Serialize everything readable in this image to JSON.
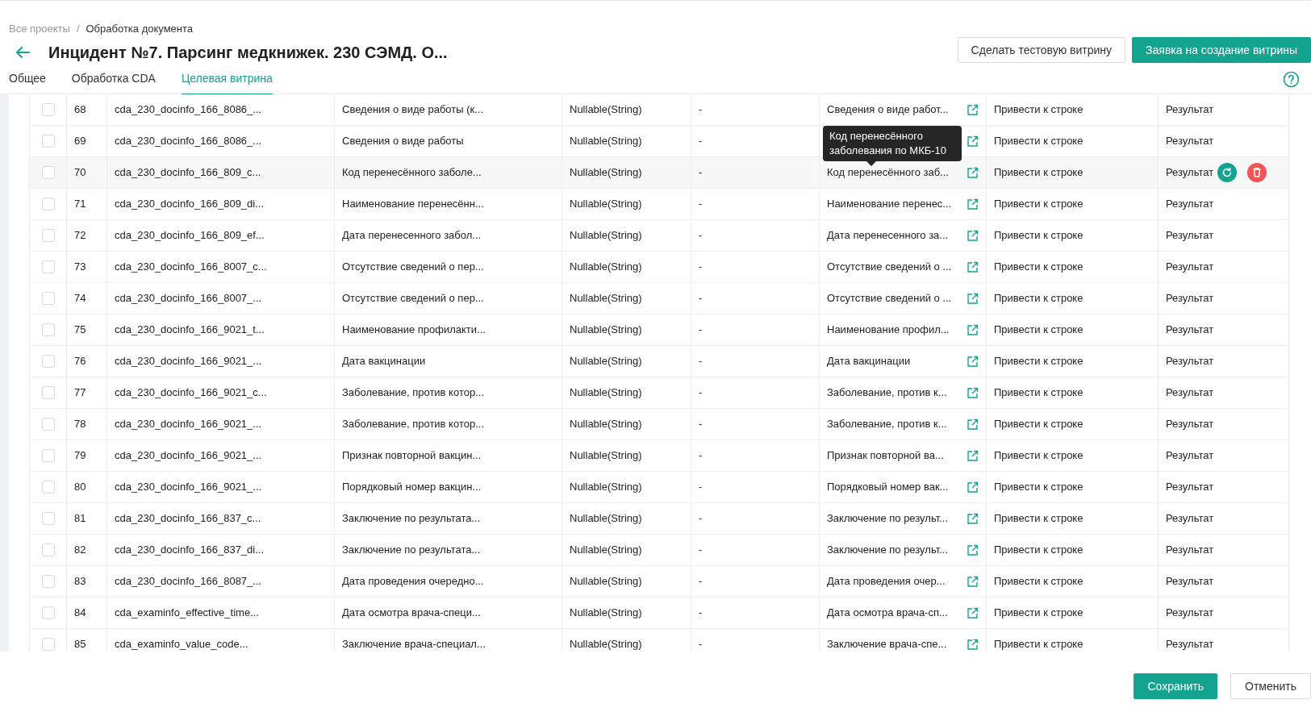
{
  "breadcrumb": {
    "separator": "/",
    "items": [
      {
        "label": "Все проекты",
        "current": false
      },
      {
        "label": "Обработка документа",
        "current": true
      }
    ]
  },
  "title": "Инцидент №7. Парсинг медкнижек. 230 СЭМД. О...",
  "header_buttons": [
    {
      "label": "Сделать тестовую витрину",
      "kind": "secondary"
    },
    {
      "label": "Заявка на создание витрины",
      "kind": "primary"
    }
  ],
  "tabs": [
    {
      "label": "Общее",
      "selected": false
    },
    {
      "label": "Обработка CDA",
      "selected": false
    },
    {
      "label": "Целевая витрина",
      "selected": true
    }
  ],
  "table": {
    "rows": [
      {
        "checked": false,
        "number": "68",
        "column_name": "cda_230_docinfo_166_8086_...",
        "description": "Сведения о виде работы (к...",
        "type": "Nullable(String)",
        "column_5": "-",
        "target": "Сведения о виде работ...",
        "transform": "Привести к строке",
        "column_8": "Результат",
        "hovered": false
      },
      {
        "checked": false,
        "number": "69",
        "column_name": "cda_230_docinfo_166_8086_...",
        "description": "Сведения о виде работы",
        "type": "Nullable(String)",
        "column_5": "-",
        "transform": "Привести к строке",
        "column_8": "Результат",
        "hovered": false
      },
      {
        "checked": false,
        "number": "70",
        "column_name": "cda_230_docinfo_166_809_c...",
        "description": "Код перенесённого заболе...",
        "type": "Nullable(String)",
        "column_5": "-",
        "target": "Код перенесённого заб...",
        "transform": "Привести к строке",
        "column_8": "Результат",
        "hovered": true
      },
      {
        "checked": false,
        "number": "71",
        "column_name": "cda_230_docinfo_166_809_di...",
        "description": "Наименование перенесённ...",
        "type": "Nullable(String)",
        "column_5": "-",
        "target": "Наименование перенес...",
        "transform": "Привести к строке",
        "column_8": "Результат",
        "hovered": false
      },
      {
        "checked": false,
        "number": "72",
        "column_name": "cda_230_docinfo_166_809_ef...",
        "description": "Дата перенесенного забол...",
        "type": "Nullable(String)",
        "column_5": "-",
        "target": "Дата перенесенного за...",
        "transform": "Привести к строке",
        "column_8": "Результат",
        "hovered": false
      },
      {
        "checked": false,
        "number": "73",
        "column_name": "cda_230_docinfo_166_8007_c...",
        "description": "Отсутствие сведений о пер...",
        "type": "Nullable(String)",
        "column_5": "-",
        "target": "Отсутствие сведений о ...",
        "transform": "Привести к строке",
        "column_8": "Результат",
        "hovered": false
      },
      {
        "checked": false,
        "number": "74",
        "column_name": "cda_230_docinfo_166_8007_...",
        "description": "Отсутствие сведений о пер...",
        "type": "Nullable(String)",
        "column_5": "-",
        "target": "Отсутствие сведений о ...",
        "transform": "Привести к строке",
        "column_8": "Результат",
        "hovered": false
      },
      {
        "checked": false,
        "number": "75",
        "column_name": "cda_230_docinfo_166_9021_t...",
        "description": "Наименование профилакти...",
        "type": "Nullable(String)",
        "column_5": "-",
        "target": "Наименование профил...",
        "transform": "Привести к строке",
        "column_8": "Результат",
        "hovered": false
      },
      {
        "checked": false,
        "number": "76",
        "column_name": "cda_230_docinfo_166_9021_...",
        "description": "Дата вакцинации",
        "type": "Nullable(String)",
        "column_5": "-",
        "target": "Дата вакцинации",
        "transform": "Привести к строке",
        "column_8": "Результат",
        "hovered": false
      },
      {
        "checked": false,
        "number": "77",
        "column_name": "cda_230_docinfo_166_9021_c...",
        "description": "Заболевание, против котор...",
        "type": "Nullable(String)",
        "column_5": "-",
        "target": "Заболевание, против к...",
        "transform": "Привести к строке",
        "column_8": "Результат",
        "hovered": false
      },
      {
        "checked": false,
        "number": "78",
        "column_name": "cda_230_docinfo_166_9021_...",
        "description": "Заболевание, против котор...",
        "type": "Nullable(String)",
        "column_5": "-",
        "target": "Заболевание, против к...",
        "transform": "Привести к строке",
        "column_8": "Результат",
        "hovered": false
      },
      {
        "checked": false,
        "number": "79",
        "column_name": "cda_230_docinfo_166_9021_...",
        "description": "Признак повторной вакцин...",
        "type": "Nullable(String)",
        "column_5": "-",
        "target": "Признак повторной ва...",
        "transform": "Привести к строке",
        "column_8": "Результат",
        "hovered": false
      },
      {
        "checked": false,
        "number": "80",
        "column_name": "cda_230_docinfo_166_9021_...",
        "description": "Порядковый номер вакцин...",
        "type": "Nullable(String)",
        "column_5": "-",
        "target": "Порядковый номер вак...",
        "transform": "Привести к строке",
        "column_8": "Результат",
        "hovered": false
      },
      {
        "checked": false,
        "number": "81",
        "column_name": "cda_230_docinfo_166_837_c...",
        "description": "Заключение по результата...",
        "type": "Nullable(String)",
        "column_5": "-",
        "target": "Заключение по результ...",
        "transform": "Привести к строке",
        "column_8": "Результат",
        "hovered": false
      },
      {
        "checked": false,
        "number": "82",
        "column_name": "cda_230_docinfo_166_837_di...",
        "description": "Заключение по результата...",
        "type": "Nullable(String)",
        "column_5": "-",
        "target": "Заключение по результ...",
        "transform": "Привести к строке",
        "column_8": "Результат",
        "hovered": false
      },
      {
        "checked": false,
        "number": "83",
        "column_name": "cda_230_docinfo_166_8087_...",
        "description": "Дата проведения очередно...",
        "type": "Nullable(String)",
        "column_5": "-",
        "target": "Дата проведения очер...",
        "transform": "Привести к строке",
        "column_8": "Результат",
        "hovered": false
      },
      {
        "checked": false,
        "number": "84",
        "column_name": "cda_examinfo_effective_time...",
        "description": "Дата осмотра врача-специ...",
        "type": "Nullable(String)",
        "column_5": "-",
        "target": "Дата осмотра врача-сп...",
        "transform": "Привести к строке",
        "column_8": "Результат",
        "hovered": false
      },
      {
        "checked": false,
        "number": "85",
        "column_name": "cda_examinfo_value_code...",
        "description": "Заключение врача-специал...",
        "type": "Nullable(String)",
        "column_5": "-",
        "target": "Заключение врача-спе...",
        "transform": "Привести к строке",
        "column_8": "Результат",
        "hovered": false
      }
    ]
  },
  "tooltip": {
    "text": "Код перенесённого заболевания по МКБ-10"
  },
  "footer_buttons": [
    {
      "label": "Сохранить",
      "kind": "primary"
    },
    {
      "label": "Отменить",
      "kind": "secondary"
    }
  ]
}
